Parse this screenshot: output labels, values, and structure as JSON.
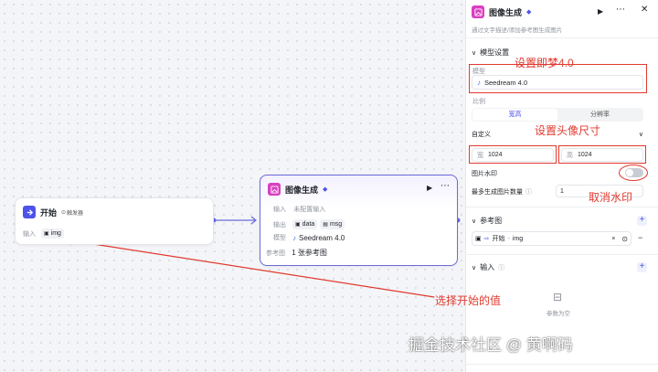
{
  "start_node": {
    "title": "开始",
    "trigger_badge": "触发器",
    "input_label": "输入",
    "input_var": "img"
  },
  "image_node": {
    "title": "图像生成",
    "rows": [
      {
        "label": "输入",
        "value": "未配置输入"
      },
      {
        "label": "输出",
        "tags": [
          "data",
          "msg"
        ]
      },
      {
        "label": "模型",
        "value": "Seedream 4.0"
      },
      {
        "label": "参考图",
        "value": "1 张参考图"
      }
    ]
  },
  "panel": {
    "title": "图像生成",
    "subtitle": "通过文字描述/添加参考图生成图片",
    "model_section": "模型设置",
    "model_label": "模型",
    "model_value": "Seedream 4.0",
    "ratio_label": "比例",
    "ratio_tabs": [
      "宽高",
      "分辨率"
    ],
    "ratio_select": "自定义",
    "width_prefix": "宽",
    "width_value": "1024",
    "height_prefix": "高",
    "height_value": "1024",
    "watermark_label": "图片水印",
    "watermark_enabled": false,
    "max_count_label": "最多生成图片数量",
    "max_count_value": "1",
    "ref_section": "参考图",
    "ref_source": "开始",
    "ref_var": "img",
    "input_section": "输入",
    "empty_params": "参数为空"
  },
  "annotations": {
    "set_model": "设置即梦4.0",
    "set_size": "设置头像尺寸",
    "cancel_watermark": "取消水印",
    "choose_start": "选择开始的值"
  },
  "watermark": "掘金技术社区 @ 黄啊码",
  "colors": {
    "accent": "#4d53e8",
    "annotation_red": "#e03a2f",
    "node_purple": "#d93fbf"
  }
}
